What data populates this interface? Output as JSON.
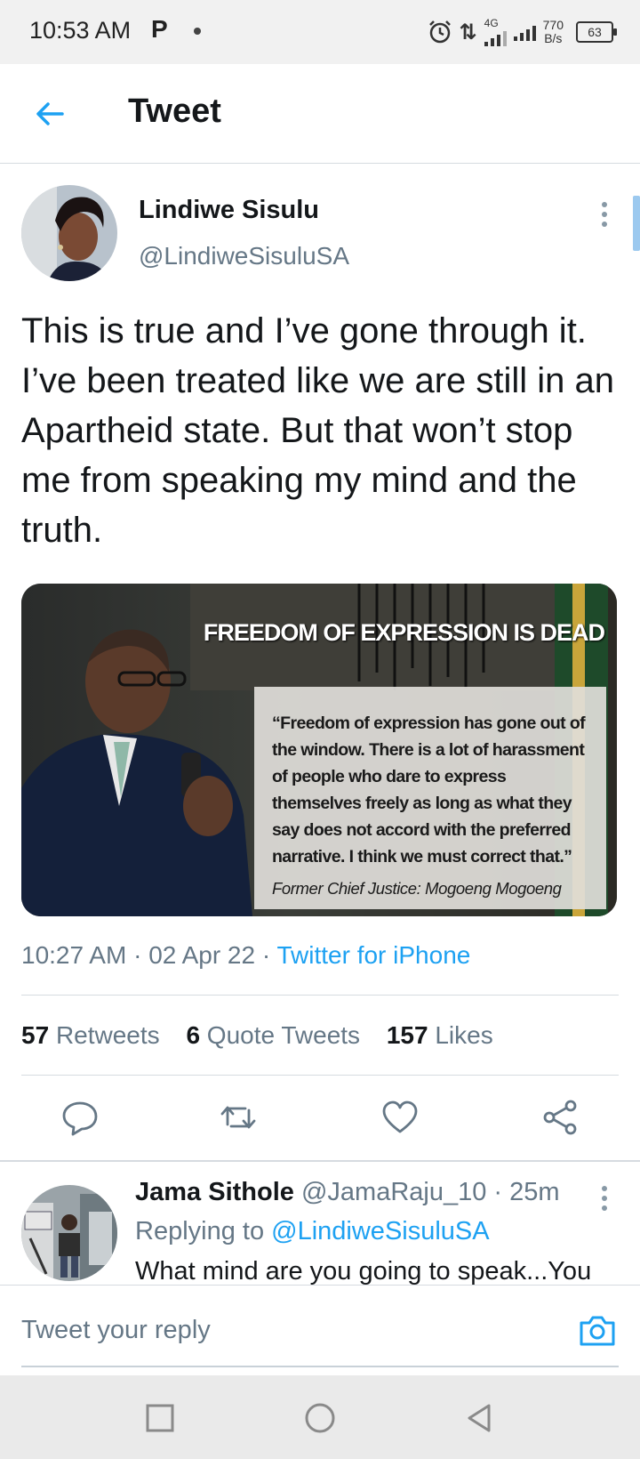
{
  "status_bar": {
    "time": "10:53 AM",
    "notification_icon": "P",
    "network": "4G",
    "speed_value": "770",
    "speed_unit": "B/s",
    "battery": "63"
  },
  "header": {
    "title": "Tweet"
  },
  "tweet": {
    "author_name": "Lindiwe Sisulu",
    "author_handle": "@LindiweSisuluSA",
    "text": "This is true and I’ve gone through it. I’ve been treated like we are still in an Apartheid state. But that won’t stop me from speaking my mind and the truth.",
    "media": {
      "headline": "FREEDOM OF EXPRESSION IS DEAD",
      "quote": "“Freedom of expression has gone out of the window. There is a lot of harassment of people who dare to express themselves freely as long as what they say does not accord with the preferred narrative. I think we must correct that.”",
      "attribution": "Former Chief Justice: Mogoeng Mogoeng"
    },
    "time": "10:27 AM",
    "date": "02 Apr 22",
    "source": "Twitter for iPhone",
    "retweets": "57",
    "retweets_label": "Retweets",
    "quote_tweets": "6",
    "quote_tweets_label": "Quote Tweets",
    "likes": "157",
    "likes_label": "Likes"
  },
  "reply": {
    "name": "Jama Sithole",
    "handle": "@JamaRaju_10",
    "time": "25m",
    "replying_to_label": "Replying to",
    "replying_to": "@LindiweSisuluSA",
    "text": "What mind are you going to speak...You"
  },
  "compose": {
    "placeholder": "Tweet your reply"
  },
  "colors": {
    "accent": "#1da1f2",
    "secondary_text": "#657786",
    "divider": "#d6dbe0"
  }
}
